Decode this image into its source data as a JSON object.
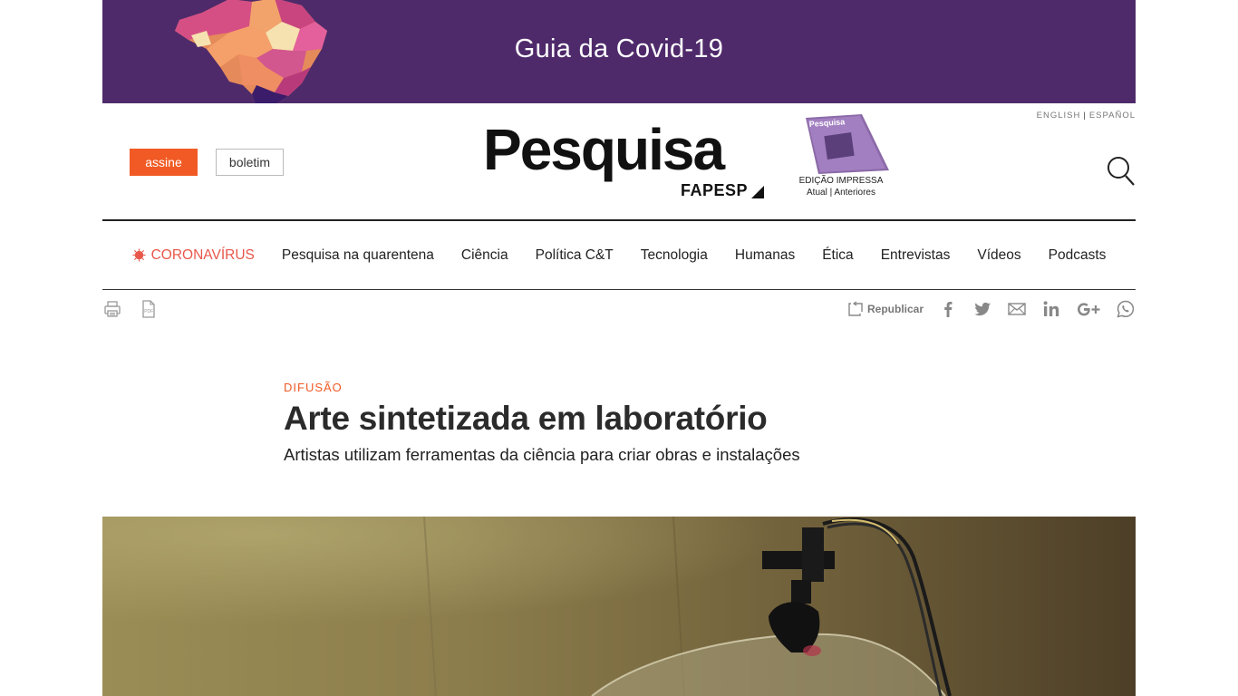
{
  "banner": {
    "title": "Guia da Covid-19"
  },
  "header": {
    "subscribe_label": "assine",
    "newsletter_label": "boletim",
    "logo_name": "Pesquisa",
    "logo_sub": "FAPESP",
    "print_edition_label": "EDIÇÃO IMPRESSA",
    "print_edition_current": "Atual",
    "print_edition_previous": "Anteriores",
    "lang_english": "ENGLISH",
    "lang_spanish": "ESPAÑOL"
  },
  "nav": {
    "items": [
      {
        "label": "CORONAVÍRUS"
      },
      {
        "label": "Pesquisa na quarentena"
      },
      {
        "label": "Ciência"
      },
      {
        "label": "Política C&T"
      },
      {
        "label": "Tecnologia"
      },
      {
        "label": "Humanas"
      },
      {
        "label": "Ética"
      },
      {
        "label": "Entrevistas"
      },
      {
        "label": "Vídeos"
      },
      {
        "label": "Podcasts"
      }
    ]
  },
  "toolbar": {
    "republish_label": "Republicar",
    "icons": [
      "print-icon",
      "pdf-icon",
      "republish-icon",
      "facebook-icon",
      "twitter-icon",
      "email-icon",
      "linkedin-icon",
      "google-plus-icon",
      "whatsapp-icon"
    ]
  },
  "article": {
    "kicker": "DIFUSÃO",
    "headline": "Arte sintetizada em laboratório",
    "deck": "Artistas utilizam ferramentas da ciência para criar obras e instalações"
  },
  "colors": {
    "banner_bg": "#4f2a6b",
    "accent_orange": "#f15a24",
    "corona_red": "#e8574a"
  }
}
